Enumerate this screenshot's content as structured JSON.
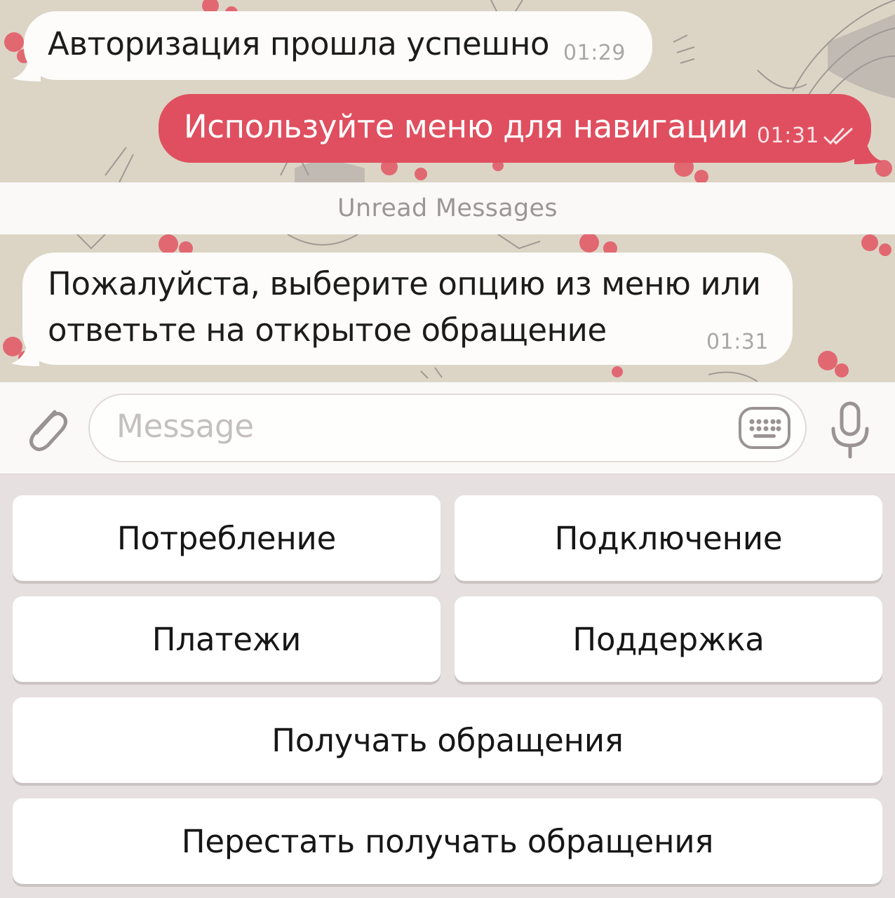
{
  "chat": {
    "messages": [
      {
        "direction": "incoming",
        "text": "Авторизация прошла успешно",
        "time": "01:29"
      },
      {
        "direction": "outgoing",
        "text": "Используйте меню для навигации",
        "time": "01:31",
        "status": "read-double-check"
      },
      {
        "direction": "incoming",
        "text": "Пожалуйста, выберите опцию из меню или ответьте на открытое обращение",
        "time": "01:31"
      }
    ],
    "unread_divider": "Unread Messages"
  },
  "composer": {
    "placeholder": "Message",
    "attach_icon": "paperclip-icon",
    "keyboard_icon": "keyboard-icon",
    "mic_icon": "microphone-icon"
  },
  "reply_keyboard": {
    "buttons": [
      "Потребление",
      "Подключение",
      "Платежи",
      "Поддержка",
      "Получать обращения",
      "Перестать получать обращения"
    ]
  },
  "colors": {
    "outgoing_bubble": "#e04f5f",
    "incoming_bubble": "#fdfcfa",
    "wallpaper": "#dcd5c6",
    "keyboard_bg": "#e7e0e0"
  }
}
